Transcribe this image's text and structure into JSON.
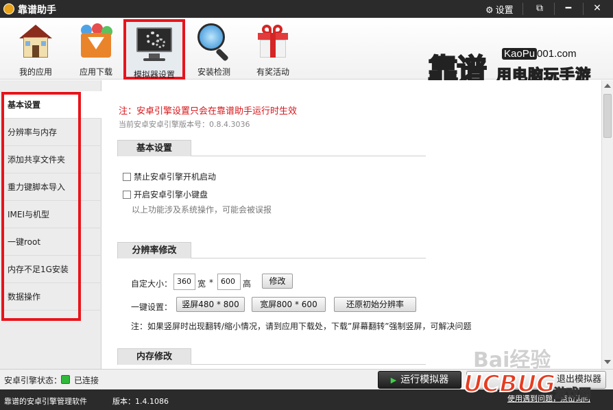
{
  "titlebar": {
    "title": "靠谱助手",
    "settings_label": "设置",
    "icons": [
      "gear-icon",
      "restore-icon",
      "minimize-icon",
      "close-icon"
    ]
  },
  "toolbar": {
    "items": [
      {
        "label": "我的应用",
        "icon": "house-icon"
      },
      {
        "label": "应用下载",
        "icon": "download-box-icon"
      },
      {
        "label": "模拟器设置",
        "icon": "monitor-gear-icon",
        "active": true
      },
      {
        "label": "安装检测",
        "icon": "magnifier-icon"
      },
      {
        "label": "有奖活动",
        "icon": "gift-icon"
      }
    ]
  },
  "brand": {
    "name": "靠谱",
    "url_prefix": "KaoPu",
    "url_suffix": "001.com",
    "slogan": "用电脑玩手游"
  },
  "sidebar": {
    "items": [
      {
        "label": "基本设置",
        "active": true
      },
      {
        "label": "分辨率与内存"
      },
      {
        "label": "添加共享文件夹"
      },
      {
        "label": "重力键脚本导入"
      },
      {
        "label": "IMEI与机型"
      },
      {
        "label": "一键root"
      },
      {
        "label": "内存不足1G安装"
      },
      {
        "label": "数据操作"
      }
    ]
  },
  "main": {
    "notice": "注：安卓引擎设置只会在靠谱助手运行时生效",
    "version_line": "当前安卓安卓引擎版本号：0.8.4.3036",
    "basic": {
      "title": "基本设置",
      "options": [
        {
          "label": "禁止安卓引擎开机启动",
          "checked": false
        },
        {
          "label": "开启安卓引擎小键盘",
          "checked": false
        }
      ],
      "hint": "以上功能涉及系统操作，可能会被误报"
    },
    "resolution": {
      "title": "分辨率修改",
      "custom_label": "自定大小：",
      "width_value": "360",
      "width_unit": "宽",
      "times": "*",
      "height_value": "600",
      "height_unit": "高",
      "modify_button": "修改",
      "onekey_label": "一键设置：",
      "portrait_button": "竖屏480 * 800",
      "landscape_button": "宽屏800 * 600",
      "restore_button": "还原初始分辨率",
      "note": "注：如果竖屏时出现翻转/缩小情况，请到应用下载处，下载”屏幕翻转”强制竖屏，可解决问题"
    },
    "memory": {
      "title": "内存修改"
    }
  },
  "statusbar": {
    "engine_label": "安卓引擎状态：",
    "engine_state": "已连接",
    "engine_color": "#2fb83a",
    "run_button": "运行模拟器",
    "close_button": "退出模拟器"
  },
  "footer": {
    "product": "靠谱的安卓引擎管理软件",
    "version": "版本：1.4.1086",
    "help_link": "使用遇到问题，点击询问"
  },
  "watermarks": {
    "ucbug": "UCBUG",
    "baidu": "Bai经验",
    "site": "游戏网"
  }
}
